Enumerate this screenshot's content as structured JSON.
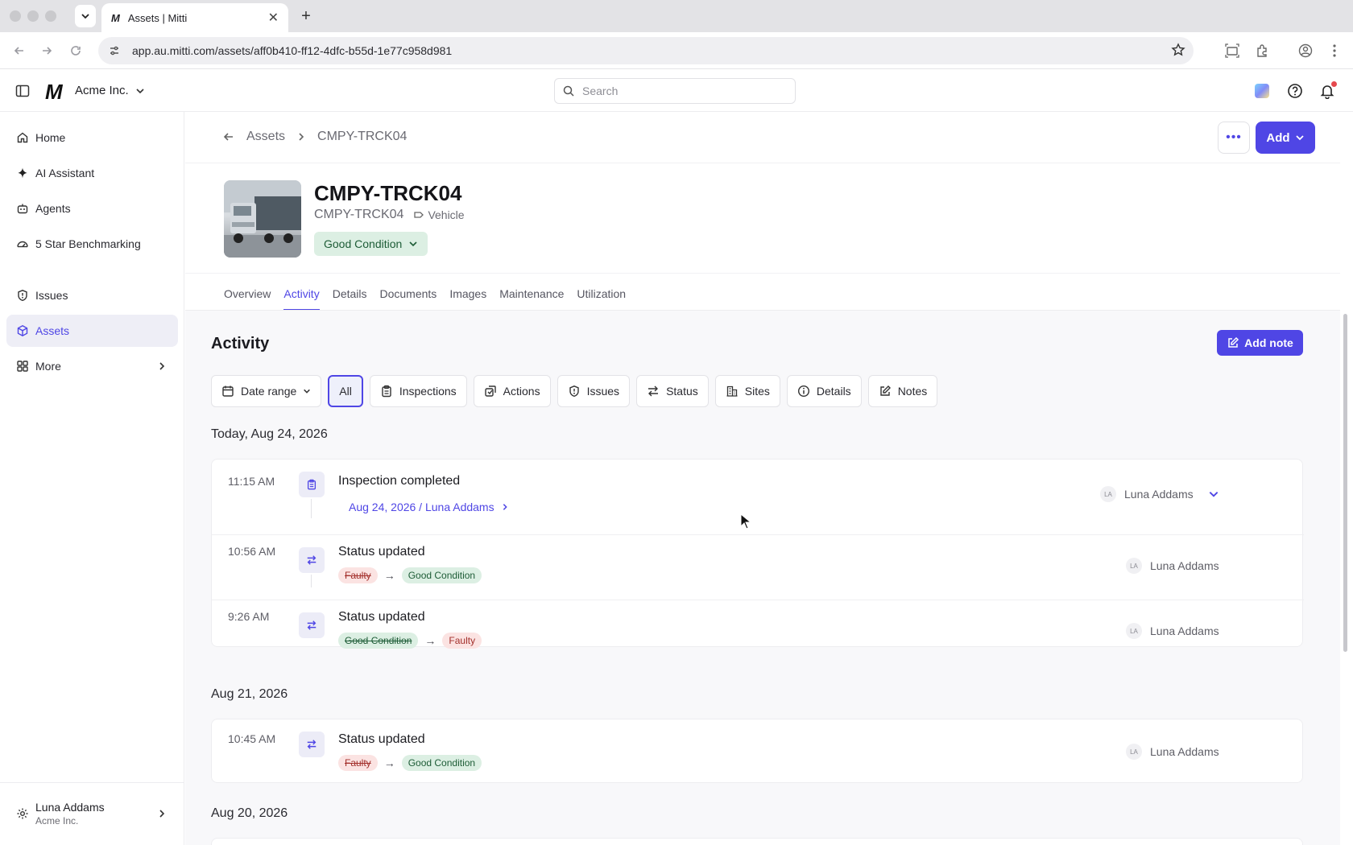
{
  "browser": {
    "tab_title": "Assets | Mitti",
    "tab_favicon": "M",
    "url": "app.au.mitti.com/assets/aff0b410-ff12-4dfc-b55d-1e77c958d981"
  },
  "app": {
    "logo": "M",
    "org_name": "Acme Inc.",
    "search_placeholder": "Search"
  },
  "sidebar": {
    "items": [
      {
        "label": "Home",
        "icon": "home-icon"
      },
      {
        "label": "AI Assistant",
        "icon": "sparkle-icon"
      },
      {
        "label": "Agents",
        "icon": "robot-icon"
      },
      {
        "label": "5 Star Benchmarking",
        "icon": "gauge-icon"
      },
      {
        "label": "Issues",
        "icon": "alert-shield-icon"
      },
      {
        "label": "Assets",
        "icon": "cube-icon"
      },
      {
        "label": "More",
        "icon": "grid-icon"
      }
    ],
    "user": {
      "name": "Luna Addams",
      "org": "Acme Inc."
    }
  },
  "header": {
    "breadcrumb_root": "Assets",
    "breadcrumb_current": "CMPY-TRCK04",
    "more_label": "•••",
    "add_label": "Add"
  },
  "asset": {
    "title": "CMPY-TRCK04",
    "code": "CMPY-TRCK04",
    "type": "Vehicle",
    "condition": "Good Condition"
  },
  "tabs": [
    "Overview",
    "Activity",
    "Details",
    "Documents",
    "Images",
    "Maintenance",
    "Utilization"
  ],
  "activity": {
    "title": "Activity",
    "add_note_label": "Add note",
    "filters": [
      "Date range",
      "All",
      "Inspections",
      "Actions",
      "Issues",
      "Status",
      "Sites",
      "Details",
      "Notes"
    ],
    "groups": [
      {
        "date": "Today, Aug 24, 2026",
        "entries": [
          {
            "time": "11:15 AM",
            "title": "Inspection completed",
            "link": "Aug 24, 2026 / Luna Addams",
            "user": "Luna Addams",
            "initials": "LA"
          },
          {
            "time": "10:56 AM",
            "title": "Status updated",
            "from": "Faulty",
            "to": "Good Condition",
            "user": "Luna Addams",
            "initials": "LA"
          },
          {
            "time": "9:26 AM",
            "title": "Status updated",
            "from": "Good Condition",
            "to": "Faulty",
            "user": "Luna Addams",
            "initials": "LA"
          }
        ]
      },
      {
        "date": "Aug 21, 2026",
        "entries": [
          {
            "time": "10:45 AM",
            "title": "Status updated",
            "from": "Faulty",
            "to": "Good Condition",
            "user": "Luna Addams",
            "initials": "LA"
          }
        ]
      },
      {
        "date": "Aug 20, 2026",
        "entries": []
      }
    ]
  },
  "colors": {
    "accent": "#4f46e5",
    "good_bg": "#dcefe3",
    "faulty_bg": "#fbe3e2"
  }
}
